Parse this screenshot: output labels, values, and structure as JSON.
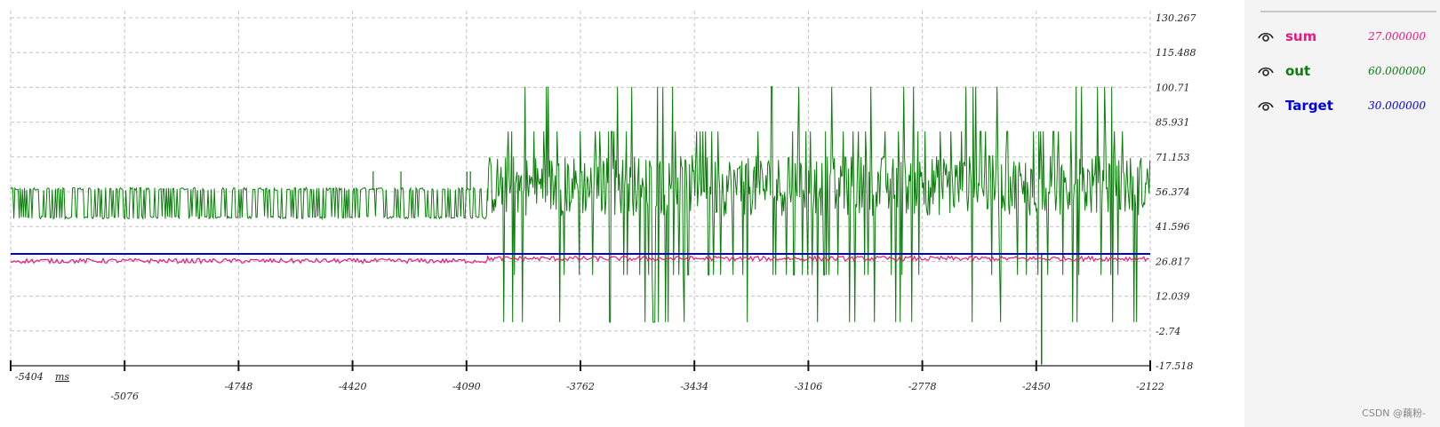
{
  "chart_data": {
    "type": "line",
    "x_unit": "ms",
    "x_ticks": [
      "-5404",
      "-5076",
      "-4748",
      "-4420",
      "-4090",
      "-3762",
      "-3434",
      "-3106",
      "-2778",
      "-2450",
      "-2122"
    ],
    "y_ticks": [
      "130.267",
      "115.488",
      "100.71",
      "85.931",
      "71.153",
      "56.374",
      "41.596",
      "26.817",
      "12.039",
      "-2.74",
      "-17.518"
    ],
    "xlim": [
      -5404,
      -2122
    ],
    "ylim": [
      -17.518,
      130.267
    ],
    "grid": true,
    "series": [
      {
        "name": "sum",
        "color": "#e8197f",
        "segments": [
          {
            "x": [
              -5404,
              -4030
            ],
            "y_range": [
              26,
              28
            ]
          },
          {
            "x": [
              -4030,
              -2122
            ],
            "y_range": [
              27,
              29
            ]
          }
        ]
      },
      {
        "name": "out",
        "color": "#0a7d0a",
        "segments": [
          {
            "x": [
              -5404,
              -4030
            ],
            "y_range": [
              46,
              57
            ],
            "spikes": [
              -4360,
              -4280,
              -4090,
              -4080
            ]
          },
          {
            "x": [
              -4030,
              -2122
            ],
            "y_range": [
              21,
              82
            ],
            "spikes_high": 101,
            "spikes_low": 1,
            "min": -17
          }
        ]
      },
      {
        "name": "Target",
        "color": "#0000cc",
        "values": [
          30,
          30
        ]
      }
    ]
  },
  "legend": [
    {
      "name": "sum",
      "value": "27.000000",
      "color": "#e8197f",
      "icon": "eye-icon"
    },
    {
      "name": "out",
      "value": "60.000000",
      "color": "#0a7d0a",
      "icon": "eye-icon"
    },
    {
      "name": "Target",
      "value": "30.000000",
      "color": "#0000dd",
      "icon": "eye-icon"
    }
  ],
  "watermark": "CSDN @藕粉-"
}
